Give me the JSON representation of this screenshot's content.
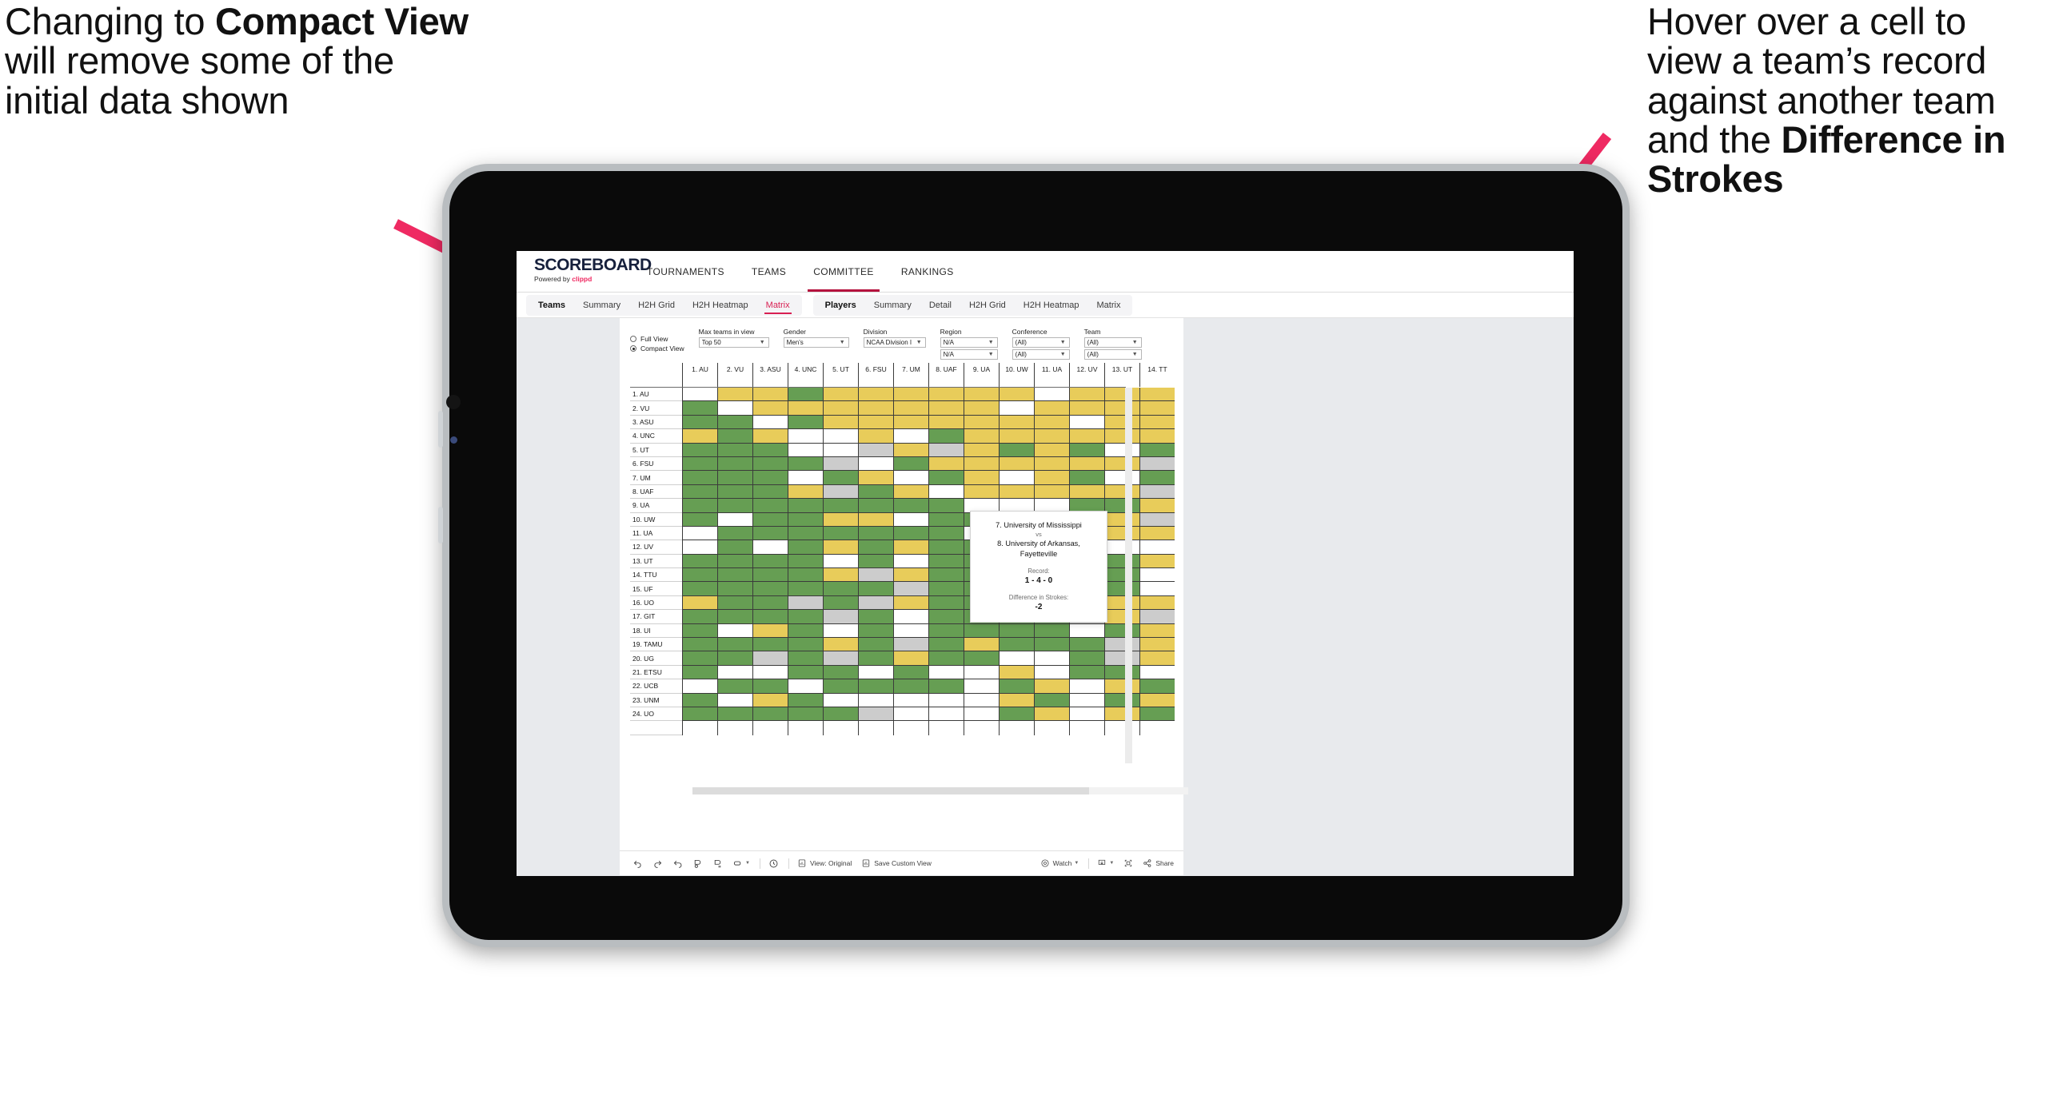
{
  "annotations": {
    "left": {
      "line1": "Changing to",
      "bold": "Compact View",
      "line2": " will remove some of the initial data shown"
    },
    "right": {
      "line1": "Hover over a cell to view a team’s record against another team and the ",
      "bold": "Difference in Strokes"
    },
    "arrow_color": "#ef2a62"
  },
  "brand": {
    "wordmark": "SCOREBOARD",
    "powered_prefix": "Powered by ",
    "powered_name": "clippd"
  },
  "topnav": {
    "items": [
      "TOURNAMENTS",
      "TEAMS",
      "COMMITTEE",
      "RANKINGS"
    ],
    "active": "COMMITTEE",
    "accent": "#b5123e"
  },
  "subnav": {
    "teams_group": {
      "lead": "Teams",
      "items": [
        "Summary",
        "H2H Grid",
        "H2H Heatmap",
        "Matrix"
      ],
      "selected": "Matrix"
    },
    "players_group": {
      "lead": "Players",
      "items": [
        "Summary",
        "Detail",
        "H2H Grid",
        "H2H Heatmap",
        "Matrix"
      ]
    }
  },
  "filters": {
    "view_mode": {
      "options": [
        "Full View",
        "Compact View"
      ],
      "selected": "Compact View"
    },
    "max_teams": {
      "label": "Max teams in view",
      "value": "Top 50"
    },
    "gender": {
      "label": "Gender",
      "value": "Men's"
    },
    "division": {
      "label": "Division",
      "value": "NCAA Division I"
    },
    "region": {
      "label": "Region",
      "value1": "N/A",
      "value2": "N/A"
    },
    "conference": {
      "label": "Conference",
      "value1": "(All)",
      "value2": "(All)"
    },
    "team": {
      "label": "Team",
      "value1": "(All)",
      "value2": "(All)"
    }
  },
  "matrix": {
    "columns": [
      "1. AU",
      "2. VU",
      "3. ASU",
      "4. UNC",
      "5. UT",
      "6. FSU",
      "7. UM",
      "8. UAF",
      "9. UA",
      "10. UW",
      "11. UA",
      "12. UV",
      "13. UT",
      "14. TT"
    ],
    "rows": [
      "1. AU",
      "2. VU",
      "3. ASU",
      "4. UNC",
      "5. UT",
      "6. FSU",
      "7. UM",
      "8. UAF",
      "9. UA",
      "10. UW",
      "11. UA",
      "12. UV",
      "13. UT",
      "14. TTU",
      "15. UF",
      "16. UO",
      "17. GIT",
      "18. UI",
      "19. TAMU",
      "20. UG",
      "21. ETSU",
      "22. UCB",
      "23. UNM",
      "24. UO"
    ],
    "legend": {
      "win": "#669e53",
      "loss": "#e8cc5a",
      "tie": "#cccccc",
      "none": "#ffffff"
    },
    "cells": [
      [
        "w",
        "y",
        "y",
        "g",
        "y",
        "y",
        "y",
        "y",
        "y",
        "y",
        "w",
        "y",
        "y",
        "y"
      ],
      [
        "g",
        "w",
        "y",
        "y",
        "y",
        "y",
        "y",
        "y",
        "y",
        "w",
        "y",
        "y",
        "y",
        "y"
      ],
      [
        "g",
        "g",
        "w",
        "g",
        "y",
        "y",
        "y",
        "y",
        "y",
        "y",
        "y",
        "w",
        "y",
        "y"
      ],
      [
        "y",
        "g",
        "y",
        "w",
        "w",
        "y",
        "w",
        "g",
        "y",
        "y",
        "y",
        "y",
        "y",
        "y"
      ],
      [
        "g",
        "g",
        "g",
        "w",
        "w",
        "a",
        "y",
        "a",
        "y",
        "g",
        "y",
        "g",
        "w",
        "g"
      ],
      [
        "g",
        "g",
        "g",
        "g",
        "a",
        "w",
        "g",
        "y",
        "y",
        "y",
        "y",
        "y",
        "y",
        "a"
      ],
      [
        "g",
        "g",
        "g",
        "w",
        "g",
        "y",
        "w",
        "g",
        "y",
        "w",
        "y",
        "g",
        "w",
        "g"
      ],
      [
        "g",
        "g",
        "g",
        "y",
        "a",
        "g",
        "y",
        "w",
        "y",
        "y",
        "y",
        "y",
        "y",
        "a"
      ],
      [
        "g",
        "g",
        "g",
        "g",
        "g",
        "g",
        "g",
        "g",
        "w",
        "w",
        "w",
        "g",
        "g",
        "y"
      ],
      [
        "g",
        "w",
        "g",
        "g",
        "y",
        "y",
        "w",
        "g",
        "g",
        "g",
        "g",
        "g",
        "y",
        "a"
      ],
      [
        "w",
        "g",
        "g",
        "g",
        "g",
        "g",
        "g",
        "g",
        "w",
        "w",
        "w",
        "w",
        "y",
        "y"
      ],
      [
        "w",
        "g",
        "w",
        "g",
        "y",
        "g",
        "y",
        "g",
        "g",
        "g",
        "g",
        "w",
        "w",
        "w"
      ],
      [
        "g",
        "g",
        "g",
        "g",
        "w",
        "g",
        "w",
        "g",
        "g",
        "g",
        "g",
        "g",
        "g",
        "y"
      ],
      [
        "g",
        "g",
        "g",
        "g",
        "y",
        "a",
        "y",
        "g",
        "g",
        "g",
        "g",
        "w",
        "g",
        "w"
      ],
      [
        "g",
        "g",
        "g",
        "g",
        "g",
        "g",
        "a",
        "g",
        "g",
        "g",
        "g",
        "w",
        "g",
        "w"
      ],
      [
        "y",
        "g",
        "g",
        "a",
        "g",
        "a",
        "y",
        "g",
        "g",
        "g",
        "g",
        "g",
        "y",
        "y"
      ],
      [
        "g",
        "g",
        "g",
        "g",
        "a",
        "g",
        "w",
        "g",
        "g",
        "g",
        "g",
        "a",
        "y",
        "a"
      ],
      [
        "g",
        "w",
        "y",
        "g",
        "w",
        "g",
        "w",
        "g",
        "g",
        "g",
        "g",
        "w",
        "g",
        "y"
      ],
      [
        "g",
        "g",
        "g",
        "g",
        "y",
        "g",
        "a",
        "g",
        "y",
        "g",
        "g",
        "g",
        "a",
        "y"
      ],
      [
        "g",
        "g",
        "a",
        "g",
        "a",
        "g",
        "y",
        "g",
        "g",
        "w",
        "w",
        "g",
        "a",
        "y"
      ],
      [
        "g",
        "w",
        "w",
        "g",
        "g",
        "w",
        "g",
        "w",
        "w",
        "y",
        "w",
        "g",
        "g",
        "w"
      ],
      [
        "w",
        "g",
        "g",
        "w",
        "g",
        "g",
        "g",
        "g",
        "w",
        "g",
        "y",
        "w",
        "y",
        "g"
      ],
      [
        "g",
        "w",
        "y",
        "g",
        "w",
        "w",
        "w",
        "w",
        "w",
        "y",
        "g",
        "w",
        "g",
        "y"
      ],
      [
        "g",
        "g",
        "g",
        "g",
        "g",
        "a",
        "w",
        "w",
        "w",
        "g",
        "y",
        "w",
        "y",
        "g"
      ]
    ]
  },
  "tooltip": {
    "team_a": "7. University of Mississippi",
    "vs": "vs",
    "team_b": "8. University of Arkansas, Fayetteville",
    "record_label": "Record:",
    "record_value": "1 - 4 - 0",
    "diff_label": "Difference in Strokes:",
    "diff_value": "-2"
  },
  "toolbar": {
    "view_original": "View: Original",
    "save_custom_view": "Save Custom View",
    "watch": "Watch",
    "share": "Share"
  }
}
